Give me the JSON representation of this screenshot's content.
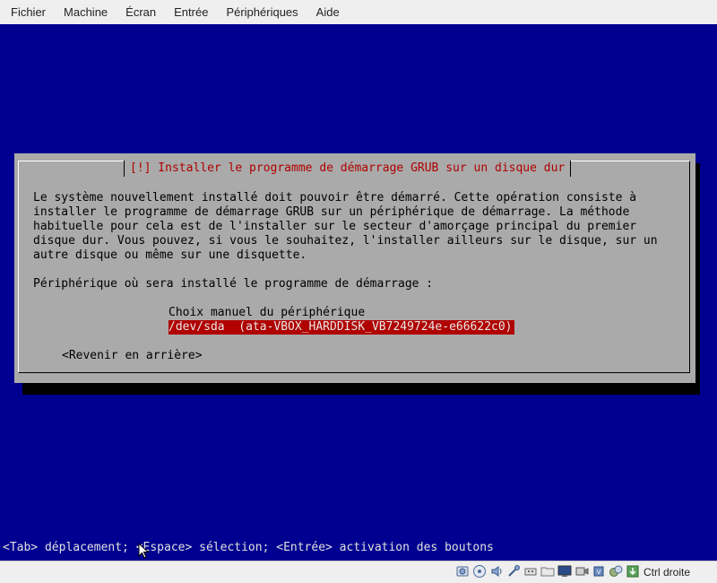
{
  "menubar": {
    "items": [
      "Fichier",
      "Machine",
      "Écran",
      "Entrée",
      "Périphériques",
      "Aide"
    ]
  },
  "dialog": {
    "title": "[!] Installer le programme de démarrage GRUB sur un disque dur",
    "body": "Le système nouvellement installé doit pouvoir être démarré. Cette opération consiste à\ninstaller le programme de démarrage GRUB sur un périphérique de démarrage. La méthode\nhabituelle pour cela est de l'installer sur le secteur d'amorçage principal du premier\ndisque dur. Vous pouvez, si vous le souhaitez, l'installer ailleurs sur le disque, sur un\nautre disque ou même sur une disquette.",
    "prompt": "Périphérique où sera installé le programme de démarrage :",
    "options": [
      "Choix manuel du périphérique",
      "/dev/sda  (ata-VBOX_HARDDISK_VB7249724e-e66622c0)"
    ],
    "selected_option": 1,
    "back_button": "<Revenir en arrière>"
  },
  "help_line": "<Tab> déplacement; <Espace> sélection; <Entrée> activation des boutons",
  "statusbar": {
    "icons": [
      "hard-disk-icon",
      "optical-drive-icon",
      "audio-icon",
      "network-icon",
      "usb-icon",
      "shared-folder-icon",
      "display-icon",
      "video-capture-icon",
      "cpu-icon",
      "mouse-integration-icon",
      "keyboard-capture-icon"
    ],
    "host_key": "Ctrl droite"
  },
  "colors": {
    "screen_bg": "#000090",
    "dialog_bg": "#aaaaaa",
    "accent_red": "#b00000"
  }
}
